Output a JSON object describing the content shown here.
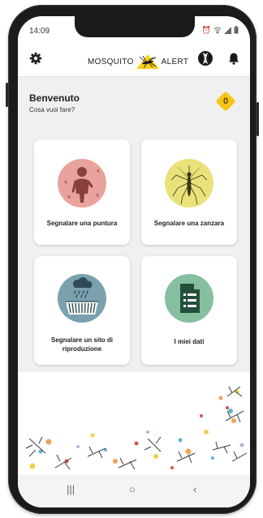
{
  "status_bar": {
    "time": "14:09",
    "icons": [
      "alarm-icon",
      "wifi-icon",
      "signal-icon",
      "battery-icon"
    ]
  },
  "app_bar": {
    "icons": [
      "gear-icon",
      "dna-icon",
      "bell-icon"
    ],
    "logo_left": "MOSQUITO",
    "logo_right": "ALERT",
    "logo_color": "#f7d117"
  },
  "welcome": {
    "title": "Benvenuto",
    "subtitle": "Cosa vuoi fare?",
    "score": "0",
    "score_color": "#f7c516"
  },
  "actions": [
    {
      "label": "Segnalare una puntura",
      "icon": "person-bite-icon",
      "color": "#e8a49c"
    },
    {
      "label": "Segnalare una zanzara",
      "icon": "mosquito-icon",
      "color": "#e9e27a"
    },
    {
      "label": "Segnalare un sito di riproduzione",
      "icon": "rain-drain-icon",
      "color": "#7aa1ad"
    },
    {
      "label": "I miei dati",
      "icon": "document-icon",
      "color": "#86bfa0"
    }
  ],
  "nav": [
    "recent-apps-icon",
    "home-icon",
    "back-icon"
  ]
}
